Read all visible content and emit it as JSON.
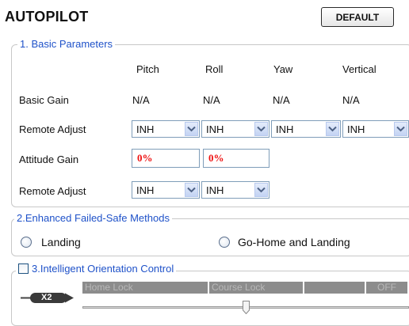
{
  "title": "AUTOPILOT",
  "default_button": "DEFAULT",
  "basic": {
    "legend": "1. Basic Parameters",
    "columns": [
      "Pitch",
      "Roll",
      "Yaw",
      "Vertical"
    ],
    "rows": {
      "basic_gain": {
        "label": "Basic Gain",
        "values": [
          "N/A",
          "N/A",
          "N/A",
          "N/A"
        ]
      },
      "remote_adjust_1": {
        "label": "Remote Adjust",
        "values": [
          "INH",
          "INH",
          "INH",
          "INH"
        ]
      },
      "attitude_gain": {
        "label": "Attitude Gain",
        "values": [
          "0%",
          "0%"
        ]
      },
      "remote_adjust_2": {
        "label": "Remote Adjust",
        "values": [
          "INH",
          "INH"
        ]
      }
    }
  },
  "failsafe": {
    "legend": "2.Enhanced Failed-Safe Methods",
    "options": [
      "Landing",
      "Go-Home and Landing"
    ]
  },
  "ioc": {
    "legend": "3.Intelligent Orientation Control",
    "segments": [
      "Home Lock",
      "Course Lock",
      "OFF"
    ],
    "switch_label": "X2"
  },
  "colors": {
    "legend_text": "#1f52c9",
    "gain_text": "#ee1111",
    "segment_bar": "#8c8c8c"
  }
}
